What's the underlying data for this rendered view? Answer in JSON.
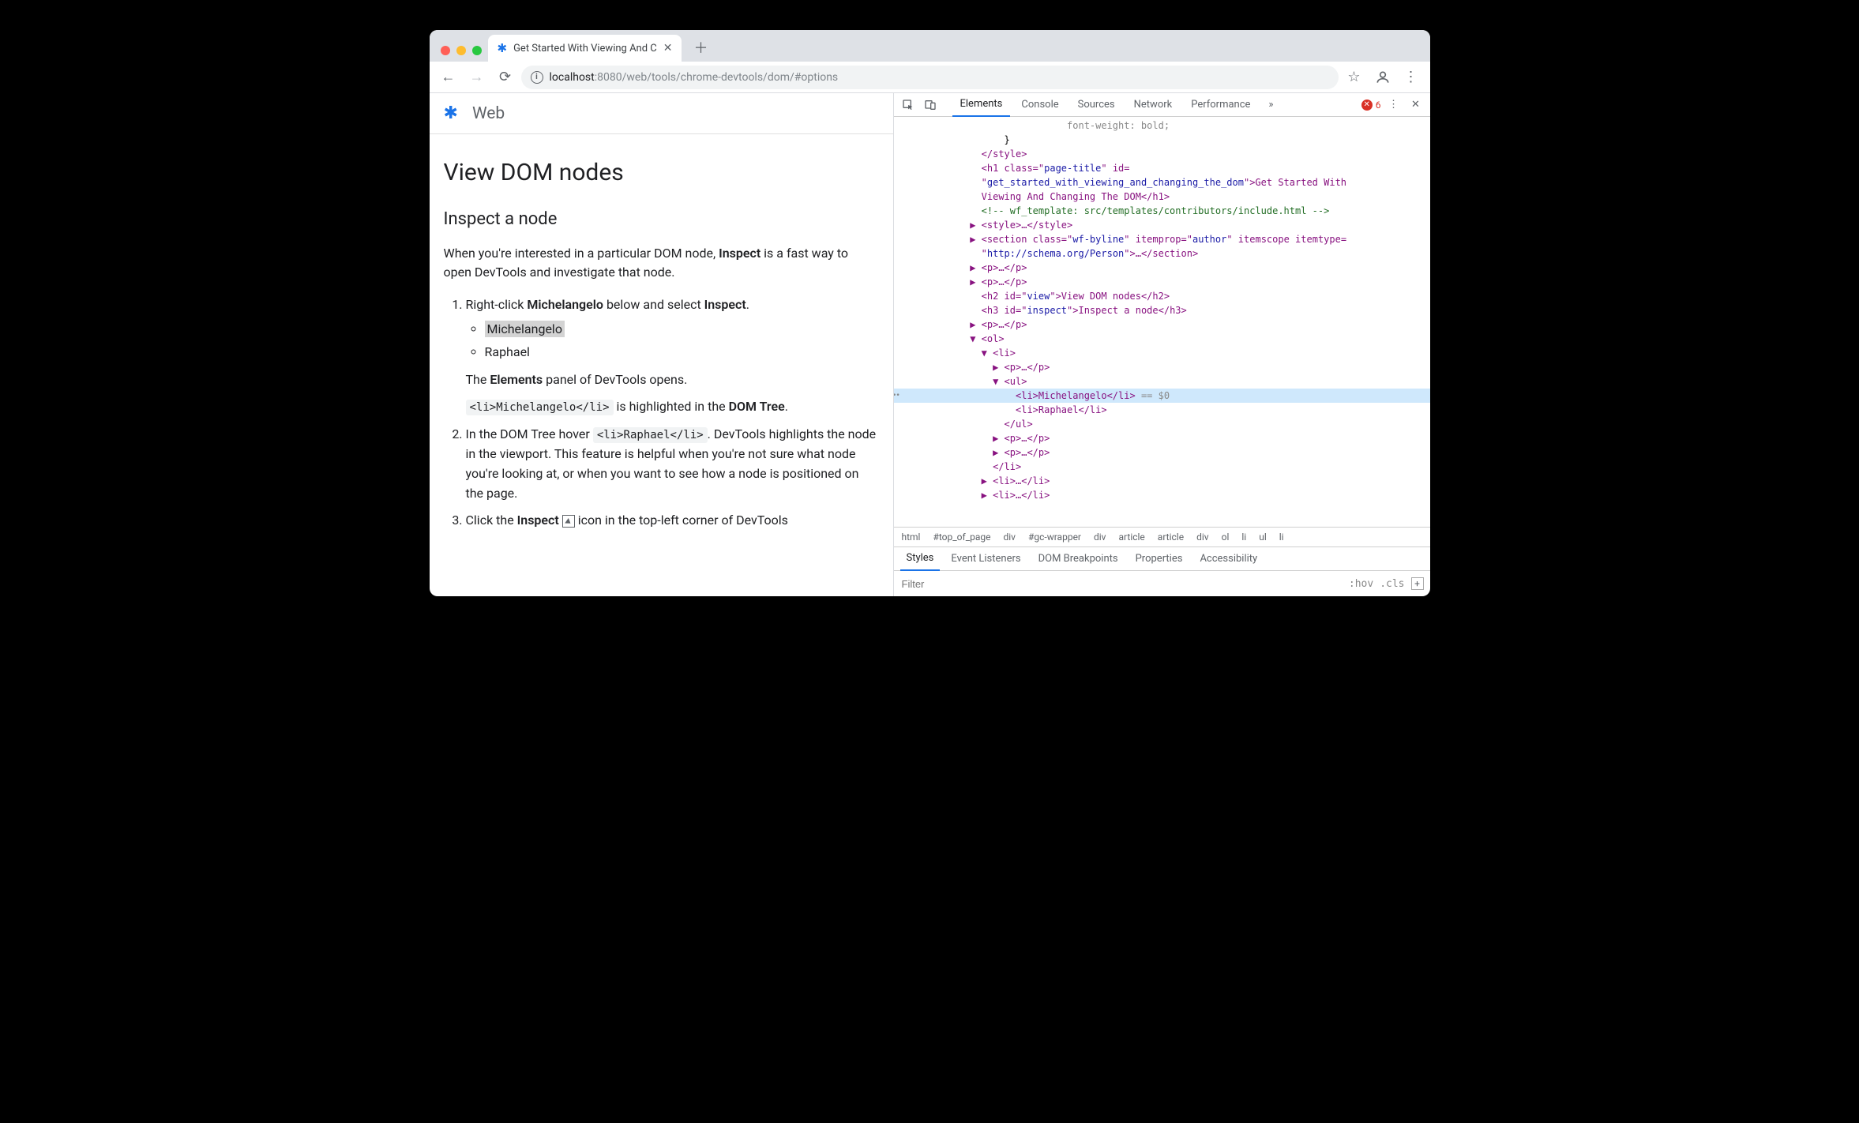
{
  "browser": {
    "tab_title": "Get Started With Viewing And C",
    "url_host": "localhost",
    "url_port": ":8080",
    "url_path": "/web/tools/chrome-devtools/dom/#options"
  },
  "page": {
    "site_section": "Web",
    "h1": "View DOM nodes",
    "h2": "Inspect a node",
    "intro_a": "When you're interested in a particular DOM node, ",
    "intro_bold": "Inspect",
    "intro_b": " is a fast way to open DevTools and investigate that node.",
    "step1_a": "Right-click ",
    "step1_b": "Michelangelo",
    "step1_c": " below and select ",
    "step1_d": "Inspect",
    "step1_e": ".",
    "li1": "Michelangelo",
    "li2": "Raphael",
    "step1_res_a": "The ",
    "step1_res_b": "Elements",
    "step1_res_c": " panel of DevTools opens.",
    "step1_code": "<li>Michelangelo</li>",
    "step1_code_after_a": " is highlighted in the ",
    "step1_code_after_b": "DOM Tree",
    "step1_code_after_c": ".",
    "step2_a": "In the DOM Tree hover ",
    "step2_code": "<li>Raphael</li>",
    "step2_b": ". DevTools highlights the node in the viewport. This feature is helpful when you're not sure what node you're looking at, or when you want to see how a node is positioned on the page.",
    "step3_a": "Click the ",
    "step3_b": "Inspect",
    "step3_c": " icon in the top-left corner of DevTools"
  },
  "devtools": {
    "tabs": [
      "Elements",
      "Console",
      "Sources",
      "Network",
      "Performance"
    ],
    "error_count": "6",
    "crumbs": [
      "html",
      "#top_of_page",
      "div",
      "#gc-wrapper",
      "div",
      "article",
      "article",
      "div",
      "ol",
      "li",
      "ul",
      "li"
    ],
    "subtabs": [
      "Styles",
      "Event Listeners",
      "DOM Breakpoints",
      "Properties",
      "Accessibility"
    ],
    "filter_placeholder": "Filter",
    "hov": ":hov",
    "cls": ".cls",
    "src": {
      "l0": "                             font-weight: bold;",
      "l1": "                  }",
      "l2": "              </style>",
      "l3a": "              <h1 class=\"",
      "l3b": "page-title",
      "l3c": "\" id=",
      "l4a": "              \"",
      "l4b": "get_started_with_viewing_and_changing_the_dom",
      "l4c": "\">Get Started With",
      "l5": "              Viewing And Changing The DOM</h1>",
      "l6": "              <!-- wf_template: src/templates/contributors/include.html -->",
      "l7": "            ▶ <style>…</style>",
      "l8a": "            ▶ <section class=\"",
      "l8b": "wf-byline",
      "l8c": "\" itemprop=\"",
      "l8d": "author",
      "l8e": "\" itemscope itemtype=",
      "l9a": "              \"",
      "l9b": "http://schema.org/Person",
      "l9c": "\">…</section>",
      "l10": "            ▶ <p>…</p>",
      "l11": "            ▶ <p>…</p>",
      "l12a": "              <h2 id=\"",
      "l12b": "view",
      "l12c": "\">View DOM nodes</h2>",
      "l13a": "              <h3 id=\"",
      "l13b": "inspect",
      "l13c": "\">Inspect a node</h3>",
      "l14": "            ▶ <p>…</p>",
      "l15": "            ▼ <ol>",
      "l16": "              ▼ <li>",
      "l17": "                ▶ <p>…</p>",
      "l18": "                ▼ <ul>",
      "sel": "                    <li>Michelangelo</li>",
      "sel_suffix": " == $0",
      "l20": "                    <li>Raphael</li>",
      "l21": "                  </ul>",
      "l22": "                ▶ <p>…</p>",
      "l23": "                ▶ <p>…</p>",
      "l24": "                </li>",
      "l25": "              ▶ <li>…</li>",
      "l26": "              ▶ <li>…</li>"
    }
  }
}
